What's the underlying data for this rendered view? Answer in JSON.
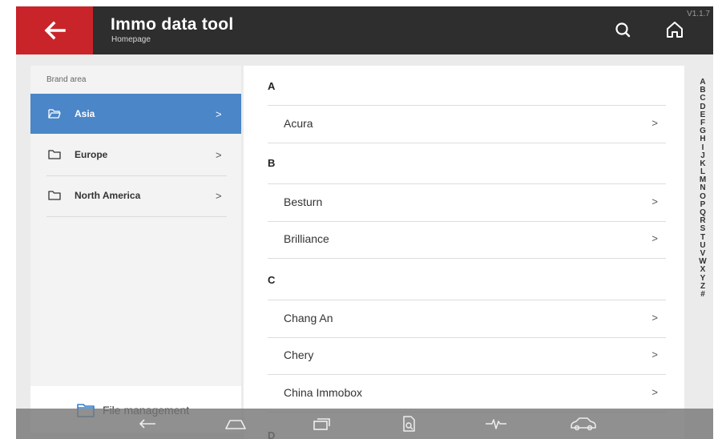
{
  "header": {
    "title": "Immo data tool",
    "subtitle": "Homepage",
    "version": "V1.1.7"
  },
  "left_panel": {
    "section_label": "Brand area",
    "regions": [
      {
        "label": "Asia",
        "active": true
      },
      {
        "label": "Europe",
        "active": false
      },
      {
        "label": "North America",
        "active": false
      }
    ],
    "file_management_label": "File management"
  },
  "brand_list": {
    "groups": [
      {
        "letter": "A",
        "brands": [
          "Acura"
        ]
      },
      {
        "letter": "B",
        "brands": [
          "Besturn",
          "Brilliance"
        ]
      },
      {
        "letter": "C",
        "brands": [
          "Chang An",
          "Chery",
          "China Immobox"
        ]
      },
      {
        "letter": "D",
        "brands": []
      }
    ]
  },
  "alphabet_index": [
    "A",
    "B",
    "C",
    "D",
    "E",
    "F",
    "G",
    "H",
    "I",
    "J",
    "K",
    "L",
    "M",
    "N",
    "O",
    "P",
    "Q",
    "R",
    "S",
    "T",
    "U",
    "V",
    "W",
    "X",
    "Y",
    "Z",
    "#"
  ],
  "chevron": ">",
  "colors": {
    "header_bg": "#2e2e2e",
    "back_button_bg": "#c8242a",
    "active_region_bg": "#4a86c8"
  },
  "icons": {
    "back": "back-arrow-icon",
    "search": "search-icon",
    "home": "home-icon",
    "folder_open": "folder-open-icon",
    "folder": "folder-icon",
    "nav_back": "nav-back-icon",
    "nav_home": "nav-home-icon",
    "nav_recents": "nav-recents-icon",
    "nav_scan": "scan-document-icon",
    "nav_diagnostic": "pulse-icon",
    "nav_car": "car-icon"
  }
}
